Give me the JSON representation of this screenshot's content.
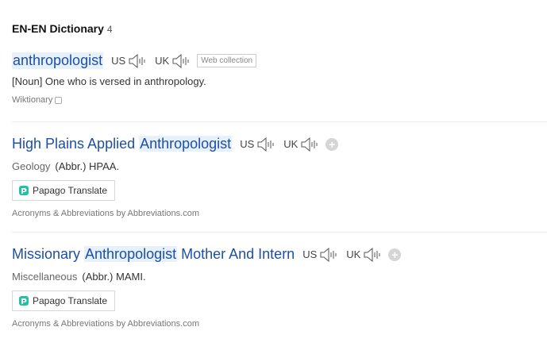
{
  "section": {
    "title": "EN-EN Dictionary",
    "count": "4"
  },
  "entries": [
    {
      "word": "anthropologist",
      "pron_us": "US",
      "pron_uk": "UK",
      "tag": "Web collection",
      "definition": "[Noun] One who is versed in anthropology.",
      "source": "Wiktionary"
    },
    {
      "word_pre": "High Plains Applied ",
      "word_hl": "Anthropologist",
      "pron_us": "US",
      "pron_uk": "UK",
      "field": "Geology",
      "definition": "(Abbr.) HPAA.",
      "translate": "Papago Translate",
      "source": "Acronyms & Abbreviations by Abbreviations.com"
    },
    {
      "word_pre": "Missionary ",
      "word_hl": "Anthropologist",
      "word_post": " Mother And Intern",
      "pron_us": "US",
      "pron_uk": "UK",
      "field": "Miscellaneous",
      "definition": "(Abbr.) MAMI.",
      "translate": "Papago Translate",
      "source": "Acronyms & Abbreviations by Abbreviations.com"
    }
  ],
  "colors": {
    "link": "#1d4fa6",
    "highlight": "#e6f1fb"
  },
  "icons": {
    "speaker": "speaker-icon",
    "add": "plus-icon",
    "papago": "papago-logo-icon",
    "external": "external-box-icon"
  }
}
